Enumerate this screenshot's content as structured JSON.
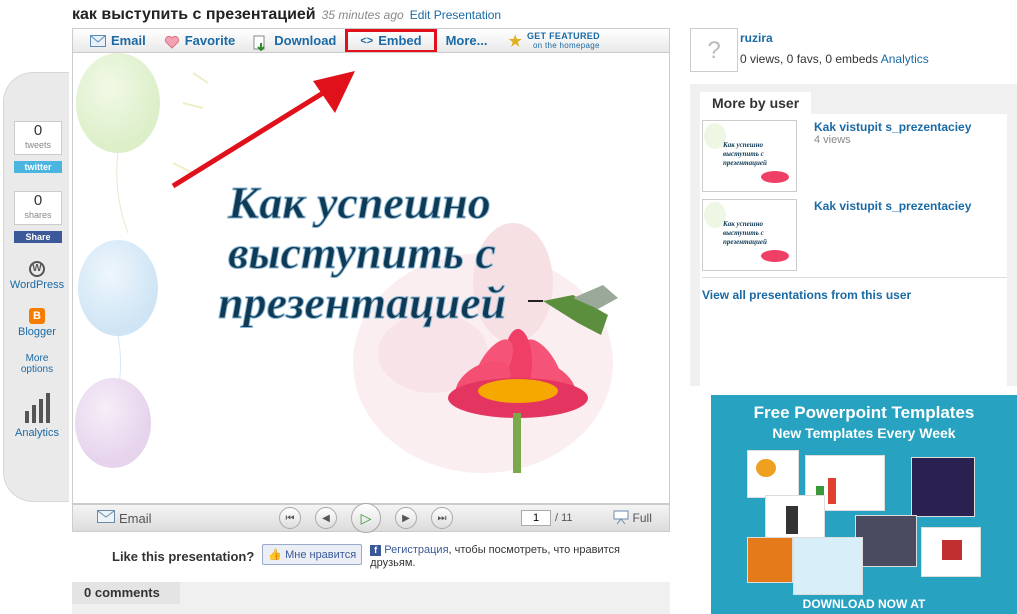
{
  "page": {
    "title": "как выступить с презентацией",
    "time_ago": "35 minutes ago",
    "edit_link": "Edit Presentation"
  },
  "toolbar": {
    "email": "Email",
    "favorite": "Favorite",
    "download": "Download",
    "embed": "Embed",
    "more": "More...",
    "featured_line1": "GET FEATURED",
    "featured_line2": "on the homepage"
  },
  "slide": {
    "text_line1": "Как успешно",
    "text_line2": "выступить с",
    "text_line3": "презентацией"
  },
  "controls": {
    "email": "Email",
    "page": "1",
    "total": "/ 11",
    "full": "Full"
  },
  "share": {
    "tweets_count": "0",
    "tweets_label": "tweets",
    "twitter_badge": "twitter",
    "shares_count": "0",
    "shares_label": "shares",
    "share_badge": "Share",
    "wordpress": "WordPress",
    "blogger": "Blogger",
    "more_options_1": "More",
    "more_options_2": "options",
    "analytics": "Analytics"
  },
  "like": {
    "question": "Like this presentation?",
    "button": "Мне нравится",
    "register_link": "Регистрация",
    "register_text": ", чтобы посмотреть, что нравится друзьям."
  },
  "comments": {
    "label": "0 comments"
  },
  "user": {
    "avatar_glyph": "?",
    "name": "ruzira",
    "stats": "0 views, 0 favs, 0 embeds",
    "analytics_link": "Analytics"
  },
  "more_by_user": {
    "heading": "More by user",
    "items": [
      {
        "title": "Kak vistupit s_prezentaciey",
        "views": "4 views"
      },
      {
        "title": "Kak vistupit s_prezentaciey",
        "views": ""
      }
    ],
    "view_all": "View all presentations from this user"
  },
  "ad": {
    "headline": "Free Powerpoint Templates",
    "subhead": "New Templates Every Week",
    "cta": "DOWNLOAD NOW AT"
  },
  "colors": {
    "link": "#1a6aa5",
    "embed_highlight": "#e0111b",
    "ad_bg": "#27a3c1",
    "slide_text": "#0e3a55"
  }
}
